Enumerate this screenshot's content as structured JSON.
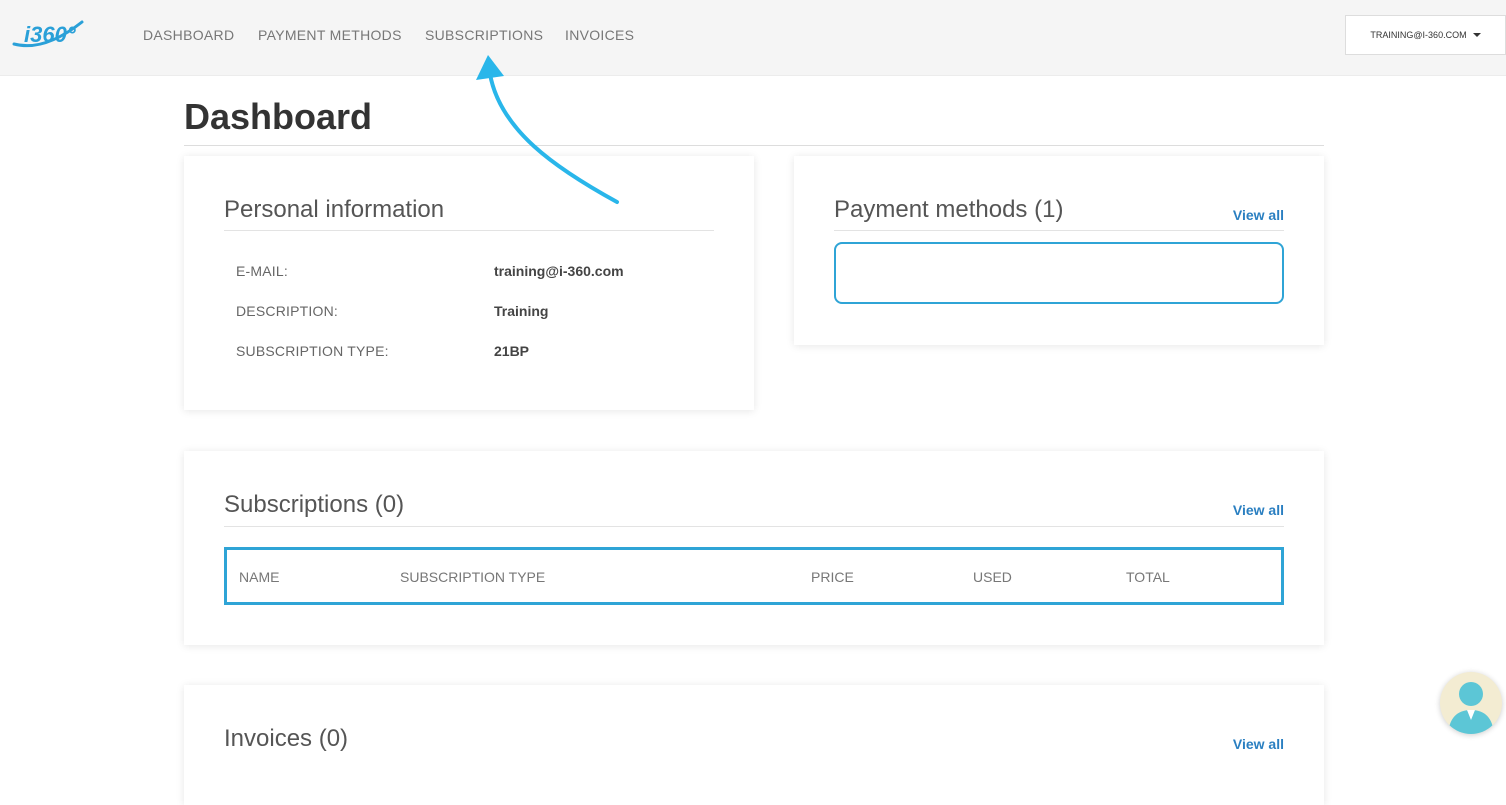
{
  "header": {
    "logo_text": "i360°",
    "nav": [
      {
        "label": "DASHBOARD"
      },
      {
        "label": "PAYMENT METHODS"
      },
      {
        "label": "SUBSCRIPTIONS"
      },
      {
        "label": "INVOICES"
      }
    ],
    "user_menu_label": "TRAINING@I-360.COM"
  },
  "page": {
    "title": "Dashboard"
  },
  "personal_info": {
    "title": "Personal information",
    "rows": [
      {
        "label": "E-MAIL:",
        "value": "training@i-360.com"
      },
      {
        "label": "DESCRIPTION:",
        "value": "Training"
      },
      {
        "label": "SUBSCRIPTION TYPE:",
        "value": "21BP"
      }
    ]
  },
  "payment_methods": {
    "title": "Payment methods (1)",
    "view_all": "View all"
  },
  "subscriptions": {
    "title": "Subscriptions (0)",
    "view_all": "View all",
    "columns": [
      "NAME",
      "SUBSCRIPTION TYPE",
      "PRICE",
      "USED",
      "TOTAL"
    ]
  },
  "invoices": {
    "title": "Invoices (0)",
    "view_all": "View all"
  },
  "colors": {
    "accent": "#2fa4d6",
    "link": "#2a7fc1",
    "arrow": "#29b6ea"
  },
  "icons": {
    "dropdown": "caret-down-icon",
    "annotation": "curved-arrow-icon",
    "support": "support-avatar-icon"
  }
}
